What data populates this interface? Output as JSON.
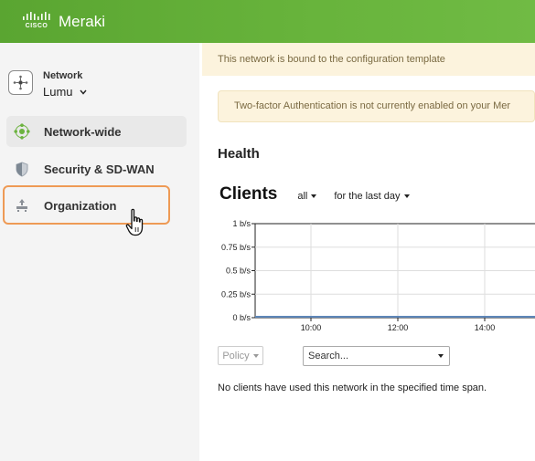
{
  "header": {
    "brand_mark": "CISCO",
    "app_name": "Meraki"
  },
  "sidebar": {
    "network_label": "Network",
    "network_name": "Lumu",
    "items": [
      {
        "label": "Network-wide",
        "icon": "network-wide-icon",
        "active": true
      },
      {
        "label": "Security & SD-WAN",
        "icon": "shield-icon",
        "active": false
      },
      {
        "label": "Organization",
        "icon": "organization-icon",
        "active": false,
        "highlighted": true
      }
    ]
  },
  "main": {
    "template_banner": "This network is bound to the configuration template",
    "twofa_banner": "Two-factor Authentication is not currently enabled on your Mer",
    "health_heading": "Health",
    "clients_title": "Clients",
    "filter_all": "all",
    "filter_time": "for the last day",
    "policy_label": "Policy",
    "search_placeholder": "Search...",
    "empty_message": "No clients have used this network in the specified time span."
  },
  "chart_data": {
    "type": "line",
    "title": "",
    "x": [
      "10:00",
      "12:00",
      "14:00"
    ],
    "y_ticks": [
      "1 b/s",
      "0.75 b/s",
      "0.5 b/s",
      "0.25 b/s",
      "0 b/s"
    ],
    "ylim": [
      0,
      1
    ],
    "series": [
      {
        "values": [
          0,
          0,
          0
        ]
      }
    ],
    "grid": true
  },
  "colors": {
    "header_green": "#67b33b",
    "highlight_orange": "#ee9a55",
    "warning_bg": "#fcf3dd",
    "series_line": "#5d86b8"
  }
}
